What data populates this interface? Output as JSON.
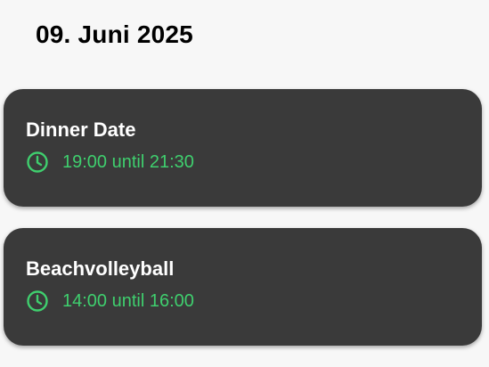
{
  "date_heading": "09. Juni 2025",
  "colors": {
    "background": "#f7f7f7",
    "card": "#3a3a3a",
    "accent_green": "#3fcf6e",
    "title_text": "#ffffff"
  },
  "events": [
    {
      "title": "Dinner Date",
      "icon": "clock-icon",
      "time": "19:00 until 21:30"
    },
    {
      "title": "Beachvolleyball",
      "icon": "clock-icon",
      "time": "14:00 until 16:00"
    }
  ]
}
